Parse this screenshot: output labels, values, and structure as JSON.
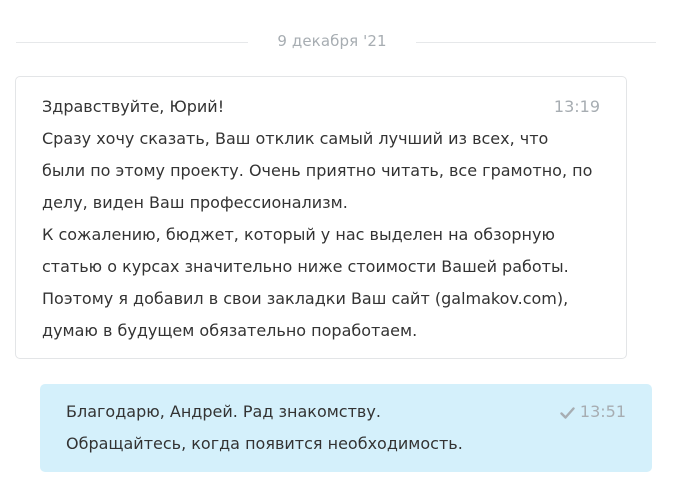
{
  "date_separator": "9 декабря '21",
  "messages": [
    {
      "direction": "incoming",
      "time": "13:19",
      "lines": [
        "Здравствуйте, Юрий!",
        "Сразу хочу сказать, Ваш отклик самый лучший из всех, что",
        "были по этому проекту. Очень приятно читать, все грамотно, по",
        "делу, виден Ваш профессионализм.",
        "К сожалению, бюджет, который у нас выделен на обзорную",
        "статью о курсах значительно ниже стоимости Вашей работы.",
        "Поэтому я добавил в свои закладки Ваш сайт (galmakov.com),",
        "думаю в будущем обязательно поработаем."
      ]
    },
    {
      "direction": "outgoing",
      "time": "13:51",
      "status_icon": "check-icon",
      "lines": [
        "Благодарю, Андрей. Рад знакомству.",
        "Обращайтесь, когда появится необходимость."
      ]
    }
  ],
  "colors": {
    "incoming_bg": "#ffffff",
    "incoming_border": "#e3e5e7",
    "outgoing_bg": "#d4f0fb",
    "muted_text": "#a7adb2",
    "body_text": "#333333"
  }
}
